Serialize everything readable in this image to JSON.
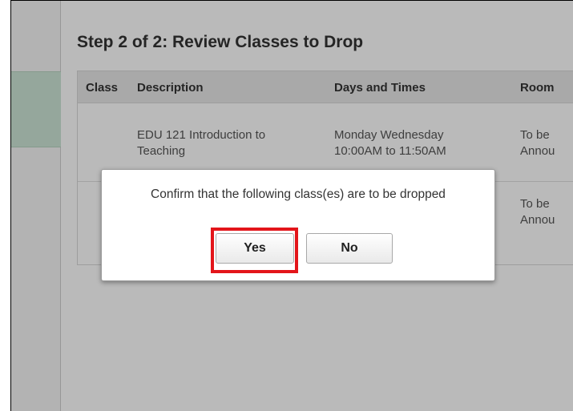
{
  "page": {
    "title": "Step 2 of 2: Review Classes to Drop"
  },
  "table": {
    "headers": [
      "Class",
      "Description",
      "Days and Times",
      "Room"
    ],
    "rows": [
      {
        "description_line1": "EDU 121  Introduction to",
        "description_line2": "Teaching",
        "days_line1": "Monday Wednesday",
        "days_line2": "10:00AM to 11:50AM",
        "room_line1": "To be",
        "room_line2": "Annou"
      },
      {
        "room_line1": "To be",
        "room_line2": "Annou"
      }
    ]
  },
  "dialog": {
    "message": "Confirm that the following class(es) are to be dropped",
    "yes_label": "Yes",
    "no_label": "No"
  },
  "colors": {
    "annotation_highlight": "#e3151a",
    "sidebar_selected": "#cde5d6"
  }
}
